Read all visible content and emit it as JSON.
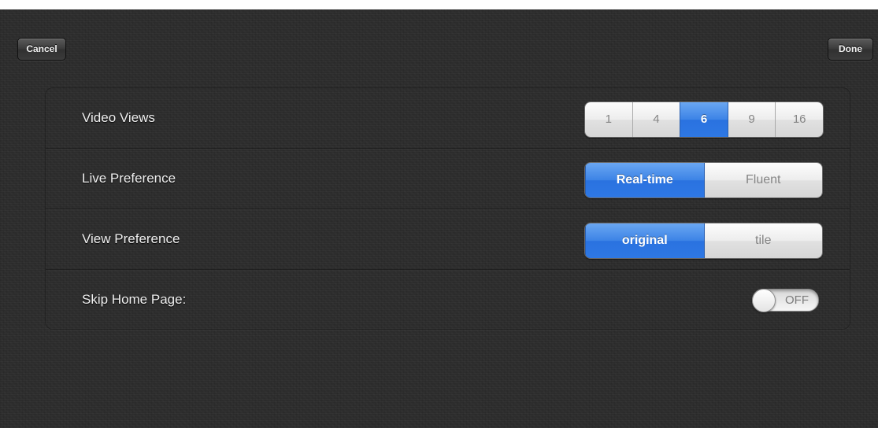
{
  "nav": {
    "cancel_label": "Cancel",
    "done_label": "Done"
  },
  "settings": {
    "video_views": {
      "label": "Video Views",
      "options": [
        "1",
        "4",
        "6",
        "9",
        "16"
      ],
      "selected": "6"
    },
    "live_preference": {
      "label": "Live Preference",
      "options": [
        "Real-time",
        "Fluent"
      ],
      "selected": "Real-time"
    },
    "view_preference": {
      "label": "View Preference",
      "options": [
        "original",
        "tile"
      ],
      "selected": "original"
    },
    "skip_home_page": {
      "label": "Skip Home Page:",
      "state_text": "OFF"
    }
  },
  "colors": {
    "selected_segment": "#3c83e6",
    "background": "#2c2c2c"
  }
}
